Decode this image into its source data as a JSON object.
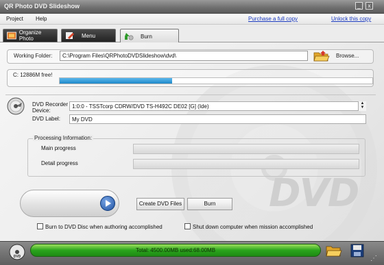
{
  "window": {
    "title": "QR Photo DVD Slideshow",
    "controls": {
      "minimize": "_",
      "close": "x"
    }
  },
  "menu": {
    "items": [
      "Project",
      "Help"
    ],
    "links": {
      "purchase": "Purchase a full copy",
      "unlock": "Unlock this copy"
    }
  },
  "tabs": [
    {
      "label": "Organize Photo",
      "active": false
    },
    {
      "label": "Menu",
      "active": false
    },
    {
      "label": "Burn",
      "active": true
    }
  ],
  "burn": {
    "working_folder_label": "Working Folder:",
    "working_folder_value": "C:\\Program Files\\QRPhotoDVDSlideshow\\dvd\\",
    "browse_label": "Browse...",
    "free_space_label": "C: 12886M free!",
    "free_space_fraction": 0.36,
    "recorder_label": "DVD Recorder Device:",
    "recorder_value": "1:0:0 - TSSTcorp CDRW/DVD TS-H492C DE02 [G] (Ide)",
    "label_label": "DVD Label:",
    "label_value": "My DVD",
    "processing_title": "Processing Information:",
    "main_progress_label": "Main progress",
    "detail_progress_label": "Detail progress",
    "create_button": "Create DVD Files",
    "burn_button": "Burn",
    "burn_checkbox_label": "Burn to DVD Disc when authoring accomplished",
    "burn_checkbox_checked": false,
    "shutdown_checkbox_label": "Shut down computer when mission accomplished",
    "shutdown_checkbox_checked": false,
    "watermark": "DVD"
  },
  "status": {
    "total_text": "Total: 4500.00MB used:68.00MB"
  },
  "colors": {
    "accent_blue": "#1e88c8",
    "status_green": "#2aa41c",
    "link_blue": "#1a3ac0"
  }
}
